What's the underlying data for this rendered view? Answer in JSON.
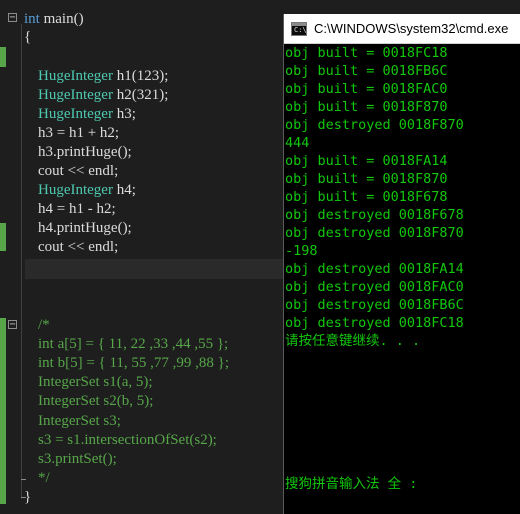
{
  "editor": {
    "lines": [
      {
        "segs": [
          {
            "t": "int",
            "c": "kw"
          },
          {
            "t": " main()",
            "c": ""
          }
        ]
      },
      {
        "segs": [
          {
            "t": "{",
            "c": ""
          }
        ]
      },
      {
        "segs": []
      },
      {
        "segs": [
          {
            "t": "HugeInteger",
            "c": "ty"
          },
          {
            "t": " h1(123);",
            "c": ""
          }
        ]
      },
      {
        "segs": [
          {
            "t": "HugeInteger",
            "c": "ty"
          },
          {
            "t": " h2(321);",
            "c": ""
          }
        ]
      },
      {
        "segs": [
          {
            "t": "HugeInteger",
            "c": "ty"
          },
          {
            "t": " h3;",
            "c": ""
          }
        ]
      },
      {
        "segs": [
          {
            "t": "h3 = h1 + h2;",
            "c": ""
          }
        ]
      },
      {
        "segs": [
          {
            "t": "h3.printHuge();",
            "c": ""
          }
        ]
      },
      {
        "segs": [
          {
            "t": "cout << endl;",
            "c": ""
          }
        ]
      },
      {
        "segs": [
          {
            "t": "HugeInteger",
            "c": "ty"
          },
          {
            "t": " h4;",
            "c": ""
          }
        ]
      },
      {
        "segs": [
          {
            "t": "h4 = h1 - h2;",
            "c": ""
          }
        ]
      },
      {
        "segs": [
          {
            "t": "h4.printHuge();",
            "c": ""
          }
        ]
      },
      {
        "segs": [
          {
            "t": "cout << endl;",
            "c": ""
          }
        ]
      },
      {
        "segs": []
      },
      {
        "segs": []
      },
      {
        "segs": []
      },
      {
        "segs": [
          {
            "t": "/*",
            "c": "cm"
          }
        ]
      },
      {
        "segs": [
          {
            "t": "int a[5] = { 11, 22 ,33 ,44 ,55 };",
            "c": "cm"
          }
        ]
      },
      {
        "segs": [
          {
            "t": "int b[5] = { 11, 55 ,77 ,99 ,88 };",
            "c": "cm"
          }
        ]
      },
      {
        "segs": [
          {
            "t": "IntegerSet s1(a, 5);",
            "c": "cm"
          }
        ]
      },
      {
        "segs": [
          {
            "t": "IntegerSet s2(b, 5);",
            "c": "cm"
          }
        ]
      },
      {
        "segs": [
          {
            "t": "IntegerSet s3;",
            "c": "cm"
          }
        ]
      },
      {
        "segs": [
          {
            "t": "s3 = s1.intersectionOfSet(s2);",
            "c": "cm"
          }
        ]
      },
      {
        "segs": [
          {
            "t": "s3.printSet();",
            "c": "cm"
          }
        ]
      },
      {
        "segs": [
          {
            "t": "*/",
            "c": "cm"
          }
        ]
      },
      {
        "segs": [
          {
            "t": "}",
            "c": ""
          }
        ]
      }
    ]
  },
  "console": {
    "title": "C:\\WINDOWS\\system32\\cmd.exe",
    "text_color": "#13c70d",
    "output": [
      "obj built = 0018FC18",
      "obj built = 0018FB6C",
      "obj built = 0018FAC0",
      "obj built = 0018F870",
      "obj destroyed 0018F870",
      "444",
      "obj built = 0018FA14",
      "obj built = 0018F870",
      "obj built = 0018F678",
      "obj destroyed 0018F678",
      "obj destroyed 0018F870",
      "-198",
      "obj destroyed 0018FA14",
      "obj destroyed 0018FAC0",
      "obj destroyed 0018FB6C",
      "obj destroyed 0018FC18",
      "请按任意键继续. . ."
    ],
    "ime_status": "搜狗拼音输入法 全 :"
  }
}
